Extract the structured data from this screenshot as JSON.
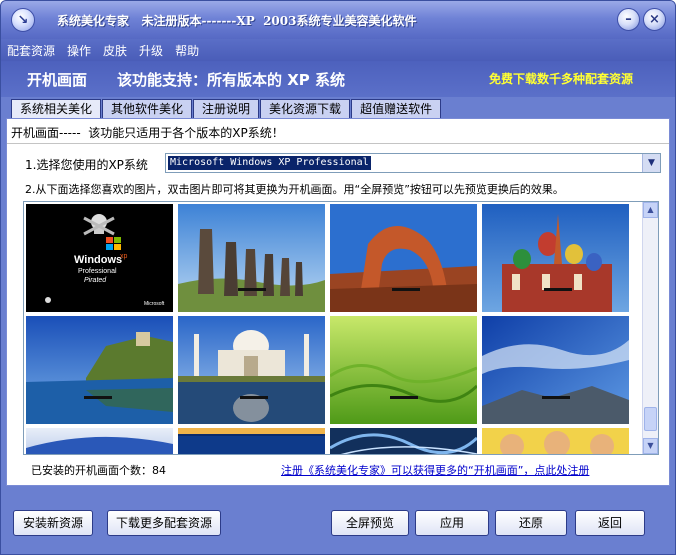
{
  "window": {
    "title": "系统美化专家   未注册版本-------XP  2003系统专业美容美化软件",
    "minimize_glyph": "–",
    "close_glyph": "×"
  },
  "menu": [
    "配套资源",
    "操作",
    "皮肤",
    "升级",
    "帮助"
  ],
  "banner": {
    "main": "开机画面",
    "sub": "该功能支持：所有版本的 XP 系统",
    "promo": "免费下载数千多种配套资源"
  },
  "tabs": [
    {
      "label": "系统相关美化",
      "active": true
    },
    {
      "label": "其他软件美化",
      "active": false
    },
    {
      "label": "注册说明",
      "active": false
    },
    {
      "label": "美化资源下载",
      "active": false
    },
    {
      "label": "超值赠送软件",
      "active": false
    }
  ],
  "content": {
    "notice": "开机画面-----  该功能只适用于各个版本的XP系统！",
    "step1_label": "1.选择您使用的XP系统",
    "os_select_value": "Microsoft Windows XP Professional",
    "step2_label": "2.从下面选择您喜欢的图片，双击图片即可将其更换为开机画面。用“全屏预览”按钮可以先预览更换后的效果。",
    "installed_count_label": "已安装的开机画面个数：84",
    "register_link": "注册《系统美化专家》可以获得更多的“开机画面”，点此处注册"
  },
  "thumb_text": {
    "windows": "Windows",
    "xp": "xp",
    "professional": "Professional",
    "pirated": "Pirated",
    "microsoft": "Microsoft"
  },
  "buttons": {
    "install_resource": "安装新资源",
    "download_more": "下载更多配套资源",
    "fullscreen_preview": "全屏预览",
    "apply": "应用",
    "restore": "还原",
    "back": "返回"
  },
  "colors": {
    "chrome_blue": "#6a7fd0",
    "promo_yellow": "#ffff33",
    "link_blue": "#0000cc"
  }
}
